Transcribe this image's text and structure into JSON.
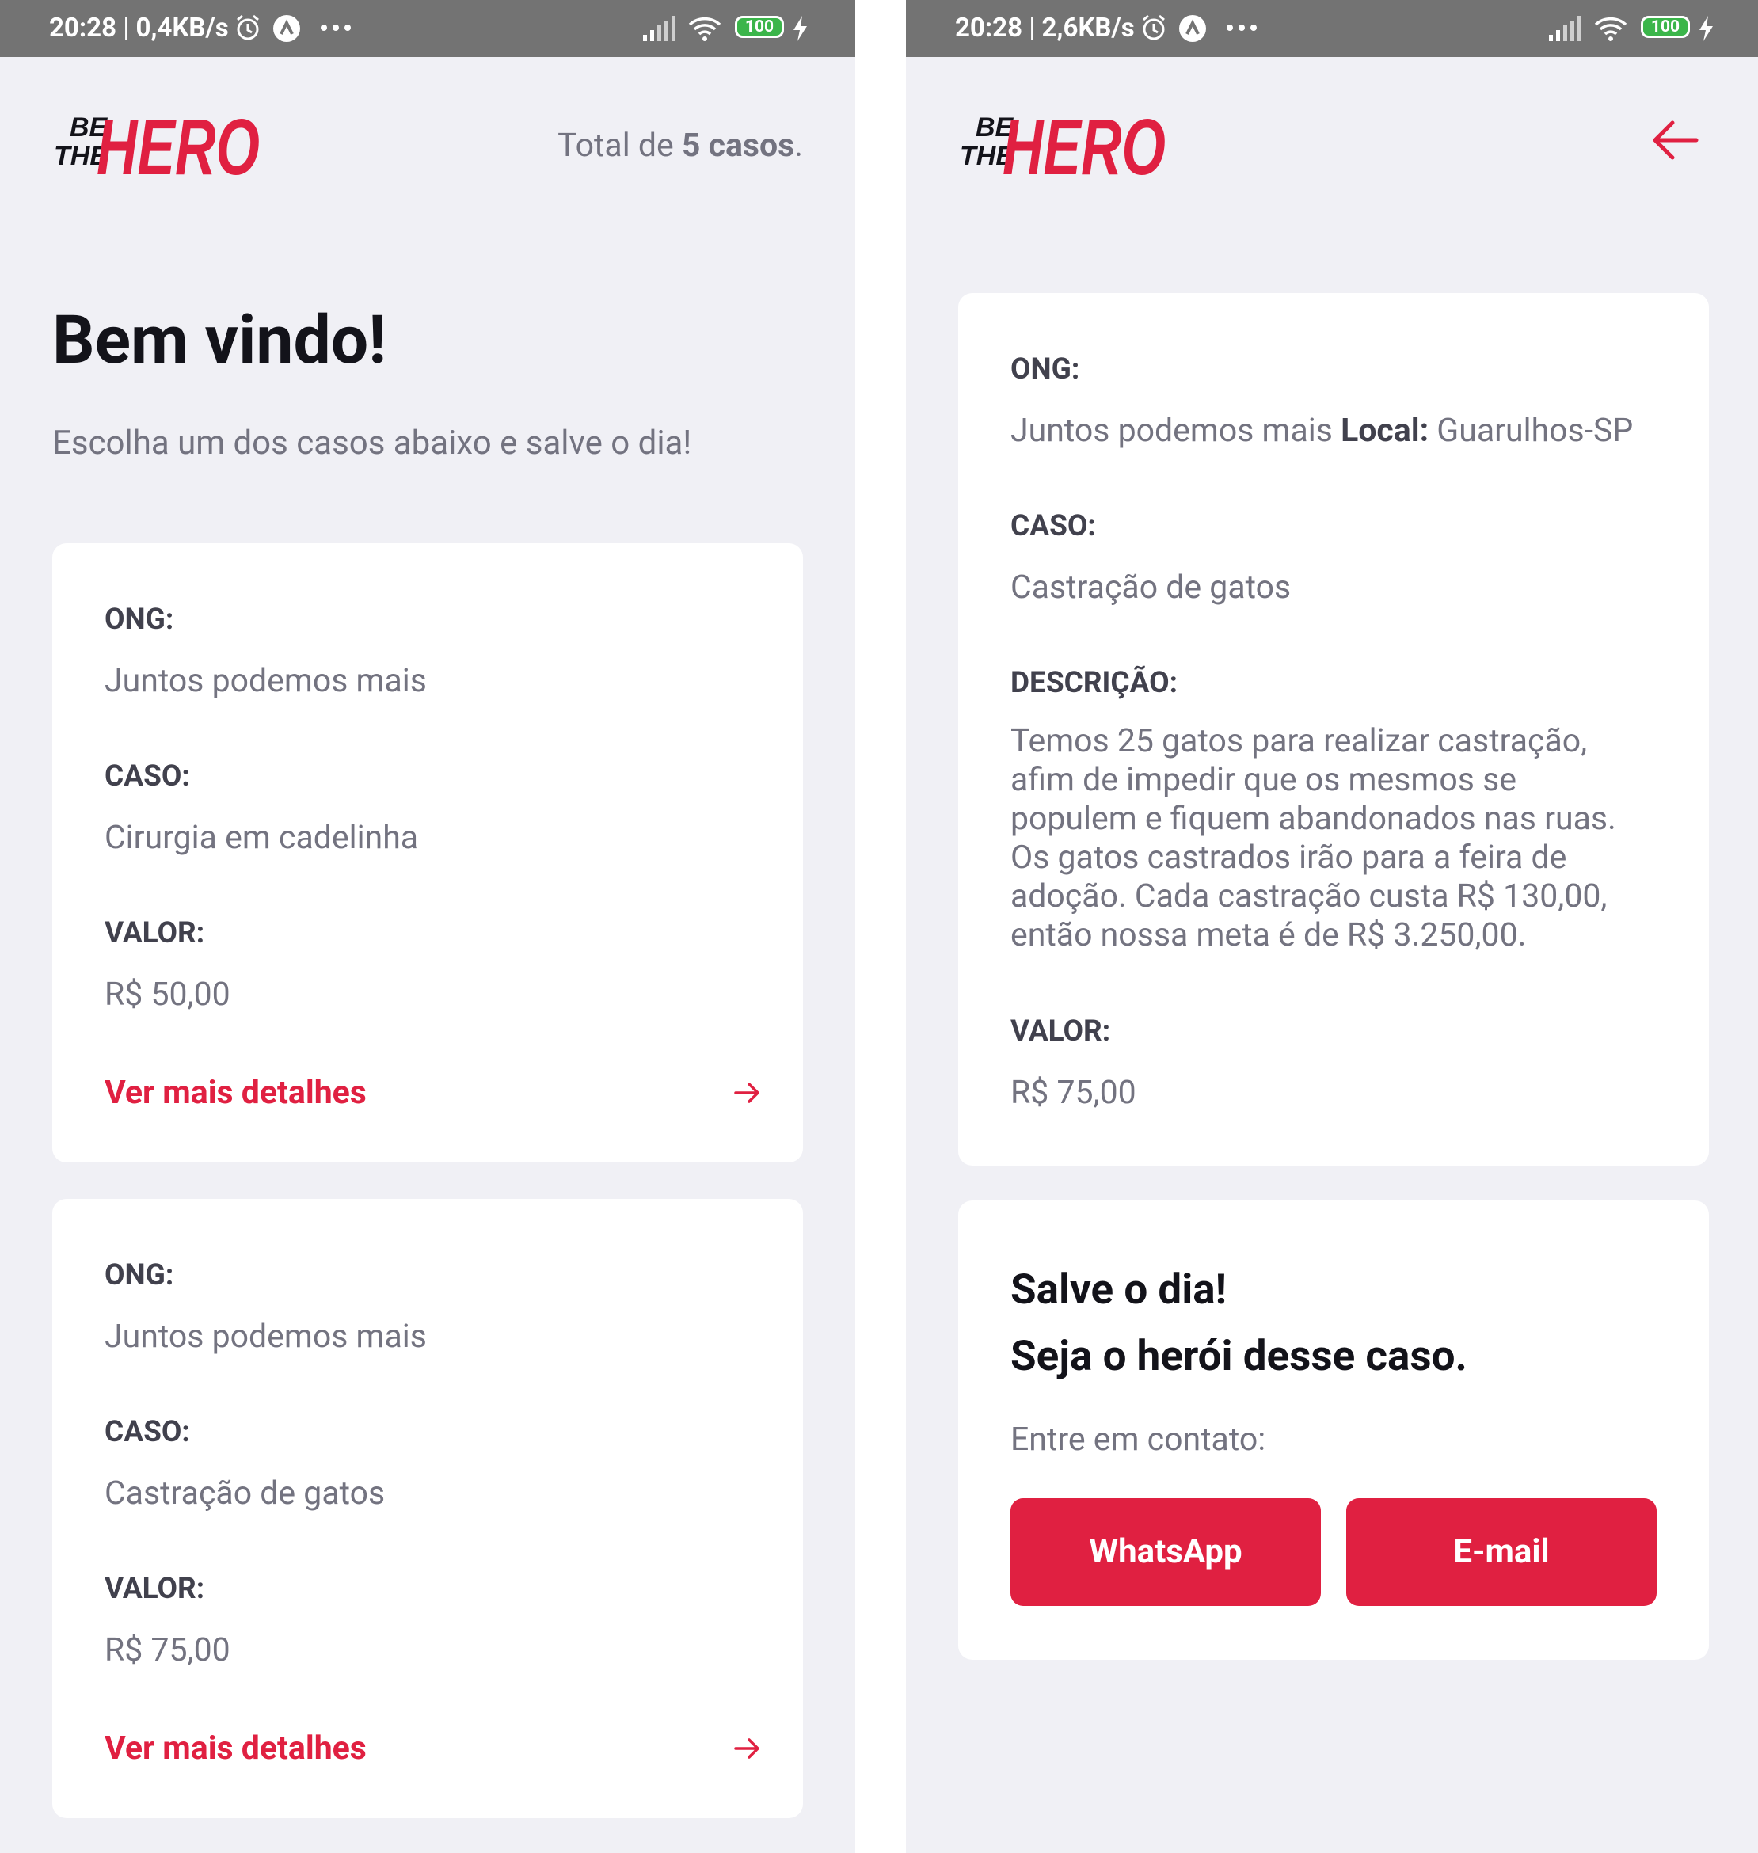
{
  "colors": {
    "accent": "#e02041",
    "background": "#f0f0f5",
    "statusbar": "#737373"
  },
  "logo": {
    "be": "BE",
    "the": "THE",
    "hero": "HERO"
  },
  "left": {
    "statusbar": {
      "time": "20:28",
      "speed": "0,4KB/s",
      "battery": "100"
    },
    "header": {
      "total_prefix": "Total de ",
      "total_count": "5 casos",
      "total_suffix": "."
    },
    "title": "Bem vindo!",
    "subtitle": "Escolha um dos casos abaixo e salve o dia!",
    "cards": [
      {
        "ong_label": "ONG:",
        "ong": "Juntos podemos mais",
        "caso_label": "CASO:",
        "caso": "Cirurgia em cadelinha",
        "valor_label": "VALOR:",
        "valor": "R$ 50,00",
        "link": "Ver mais detalhes"
      },
      {
        "ong_label": "ONG:",
        "ong": "Juntos podemos mais",
        "caso_label": "CASO:",
        "caso": "Castração de gatos",
        "valor_label": "VALOR:",
        "valor": "R$ 75,00",
        "link": "Ver mais detalhes"
      }
    ]
  },
  "right": {
    "statusbar": {
      "time": "20:28",
      "speed": "2,6KB/s",
      "battery": "100"
    },
    "detail": {
      "ong_label": "ONG:",
      "ong": "Juntos podemos mais ",
      "local_label": "Local:",
      "local": " Guarulhos-SP",
      "caso_label": "CASO:",
      "caso": "Castração de gatos",
      "descricao_label": "DESCRIÇÃO:",
      "descricao_lines": [
        "Temos 25 gatos para realizar castração,",
        "afim de impedir que os mesmos se",
        "populem e fiquem abandonados nas ruas.",
        "Os gatos castrados irão para a feira de",
        "adoção. Cada castração custa R$ 130,00,",
        "então nossa meta é de R$ 3.250,00."
      ],
      "valor_label": "VALOR:",
      "valor": "R$ 75,00"
    },
    "contact": {
      "title_line1": "Salve o dia!",
      "title_line2": "Seja o herói desse caso.",
      "subtitle": "Entre em contato:",
      "whatsapp": "WhatsApp",
      "email": "E-mail"
    }
  }
}
